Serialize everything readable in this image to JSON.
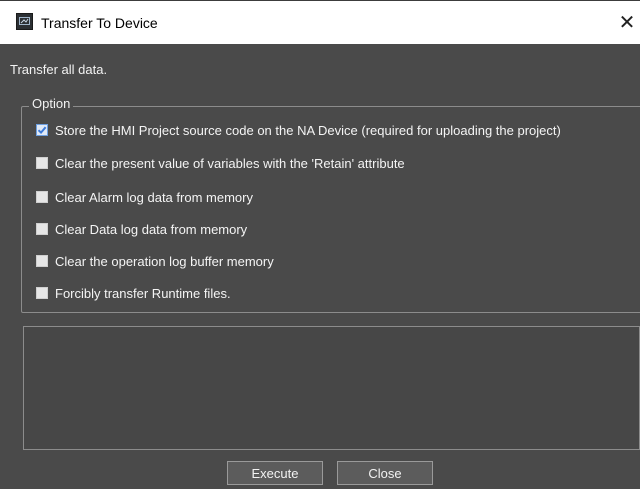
{
  "window": {
    "title": "Transfer To Device",
    "close_glyph": "✕"
  },
  "description": "Transfer all data.",
  "option_group": {
    "legend": "Option",
    "items": [
      {
        "label": "Store the HMI Project source code on the NA Device (required for uploading the project)",
        "checked": true
      },
      {
        "label": "Clear the present value of variables with the 'Retain' attribute",
        "checked": false
      },
      {
        "label": "Clear Alarm log data from memory",
        "checked": false
      },
      {
        "label": "Clear Data log data from memory",
        "checked": false
      },
      {
        "label": "Clear the operation log buffer memory",
        "checked": false
      },
      {
        "label": "Forcibly transfer Runtime files.",
        "checked": false
      }
    ]
  },
  "buttons": {
    "execute": "Execute",
    "close": "Close"
  },
  "colors": {
    "background": "#4a4a4a",
    "check_accent": "#3b7ad9"
  }
}
